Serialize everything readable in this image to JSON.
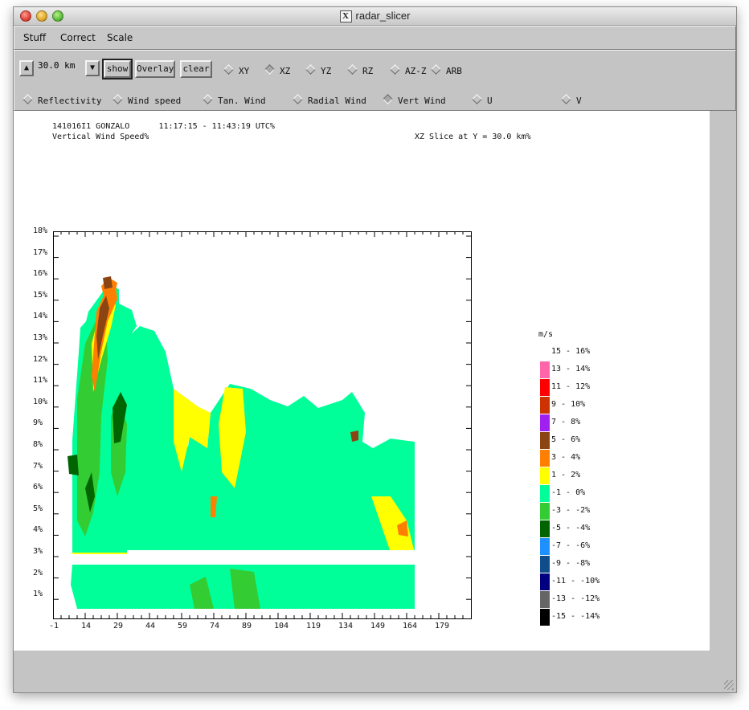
{
  "window": {
    "title": "radar_slicer"
  },
  "menubar": {
    "items": [
      "Stuff",
      "Correct",
      "Scale"
    ]
  },
  "toolbar": {
    "distance": "30.0 km",
    "show_label": "show",
    "overlay_label": "Overlay",
    "clear_label": "clear",
    "slice_options": [
      {
        "label": "XY",
        "selected": false
      },
      {
        "label": "XZ",
        "selected": true
      },
      {
        "label": "YZ",
        "selected": false
      },
      {
        "label": "RZ",
        "selected": false
      },
      {
        "label": "AZ-Z",
        "selected": false
      },
      {
        "label": "ARB",
        "selected": false
      }
    ],
    "field_options": [
      {
        "label": "Reflectivity",
        "selected": false
      },
      {
        "label": "Wind speed",
        "selected": false
      },
      {
        "label": "Tan. Wind",
        "selected": false
      },
      {
        "label": "Radial Wind",
        "selected": false
      },
      {
        "label": "Vert Wind",
        "selected": true
      },
      {
        "label": "U",
        "selected": false
      },
      {
        "label": "V",
        "selected": false
      }
    ]
  },
  "plot": {
    "header_line1": "141016I1 GONZALO      11:17:15 - 11:43:19 UTC%",
    "header_line2": "Vertical Wind Speed%",
    "slice_info": "XZ Slice at Y = 30.0 km%",
    "y_ticks": [
      "18%",
      "17%",
      "16%",
      "15%",
      "14%",
      "13%",
      "12%",
      "11%",
      "10%",
      "9%",
      "8%",
      "7%",
      "6%",
      "5%",
      "4%",
      "3%",
      "2%",
      "1%"
    ],
    "x_ticks": [
      "-1",
      "14",
      "29",
      "44",
      "59",
      "74",
      "89",
      "104",
      "119",
      "134",
      "149",
      "164",
      "179"
    ],
    "legend_unit": "m/s",
    "legend": [
      {
        "label": "15 - 16%",
        "color": "#ffffff"
      },
      {
        "label": "13 - 14%",
        "color": "#ff66aa"
      },
      {
        "label": "11 - 12%",
        "color": "#ff0000"
      },
      {
        "label": "9 - 10%",
        "color": "#cc3300"
      },
      {
        "label": "7 - 8%",
        "color": "#a020f0"
      },
      {
        "label": "5 - 6%",
        "color": "#8b4513"
      },
      {
        "label": "3 - 4%",
        "color": "#ff8000"
      },
      {
        "label": "1 - 2%",
        "color": "#ffff00"
      },
      {
        "label": "-1 - 0%",
        "color": "#00ff99"
      },
      {
        "label": "-3 - -2%",
        "color": "#33cc33"
      },
      {
        "label": "-5 - -4%",
        "color": "#006400"
      },
      {
        "label": "-7 - -6%",
        "color": "#1e90ff"
      },
      {
        "label": "-9 - -8%",
        "color": "#104e8b"
      },
      {
        "label": "-11 - -10%",
        "color": "#000080"
      },
      {
        "label": "-13 - -12%",
        "color": "#666666"
      },
      {
        "label": "-15 - -14%",
        "color": "#000000"
      }
    ]
  }
}
